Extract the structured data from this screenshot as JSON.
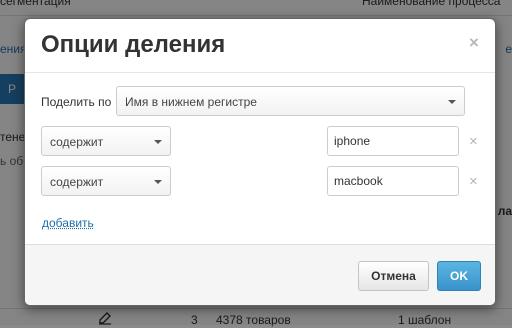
{
  "background": {
    "top_left": "сегментация",
    "top_right": "Наименование процесса",
    "tab_left": "ения",
    "tab_right": "е",
    "blue_tab": "Р",
    "row_left_1": "тене",
    "row_left_2": "ь об",
    "bold_right": "ла",
    "bottom_row": {
      "number": "3",
      "products": "4378 товаров",
      "template": "1 шаблон"
    }
  },
  "modal": {
    "title": "Опции деления",
    "close_glyph": "×",
    "split_by_label": "Поделить по",
    "split_by_value": "Имя в нижнем регистре",
    "conditions": [
      {
        "operator": "содержит",
        "value": "iphone"
      },
      {
        "operator": "содержит",
        "value": "macbook"
      }
    ],
    "remove_glyph": "×",
    "add_link": "добавить",
    "cancel_button": "Отмена",
    "ok_button": "OK"
  },
  "colors": {
    "primary": "#3993cb",
    "link": "#1f6ea8"
  }
}
